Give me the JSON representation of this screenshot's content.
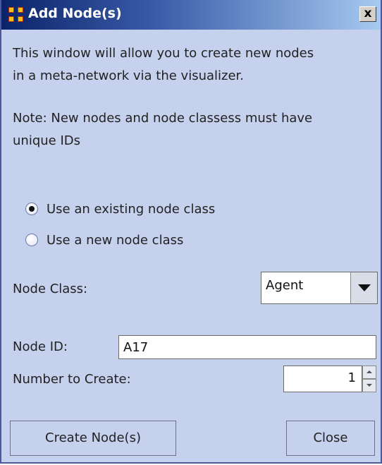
{
  "window": {
    "title": "Add Node(s)",
    "close_glyph": "x"
  },
  "intro": {
    "line1": "This window will allow you to create new nodes",
    "line2": "in a meta-network via the visualizer.",
    "note1": "Note: New nodes and node classess must have",
    "note2": "unique IDs"
  },
  "options": {
    "existing_label": "Use an existing node class",
    "existing_selected": true,
    "new_label": "Use a new node class",
    "new_selected": false
  },
  "node_class": {
    "label": "Node Class:",
    "value": "Agent"
  },
  "node_id": {
    "label": "Node ID:",
    "value": "A17"
  },
  "number_to_create": {
    "label": "Number to Create:",
    "value": "1"
  },
  "buttons": {
    "create": "Create Node(s)",
    "close": "Close"
  }
}
